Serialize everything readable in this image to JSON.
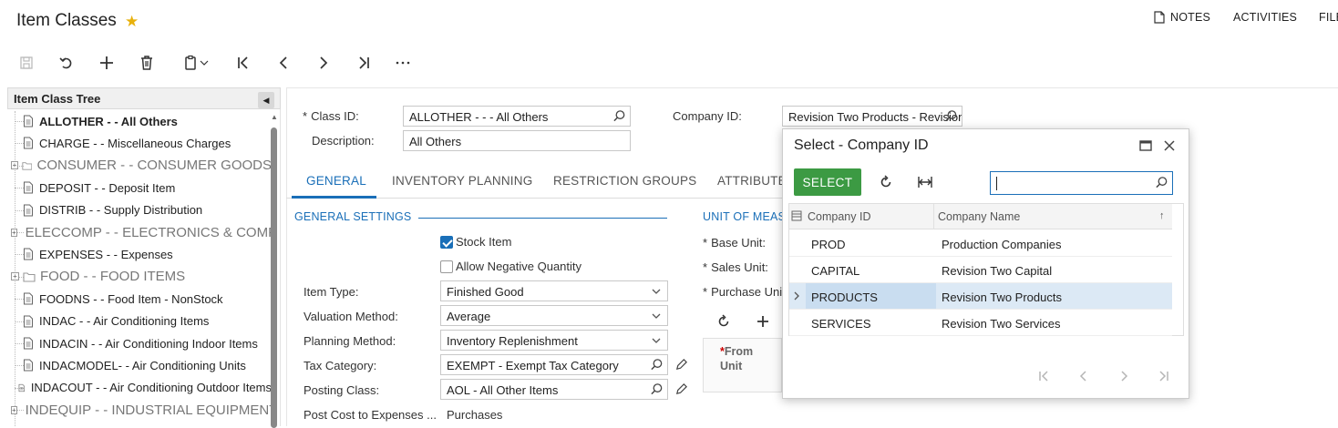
{
  "header": {
    "title": "Item Classes",
    "links": [
      "NOTES",
      "ACTIVITIES",
      "FILE"
    ]
  },
  "tree": {
    "title": "Item Class Tree",
    "items": [
      {
        "label": "ALLOTHER - - All Others",
        "type": "doc",
        "selected": true
      },
      {
        "label": "CHARGE - - Miscellaneous Charges",
        "type": "doc"
      },
      {
        "label": "CONSUMER - - CONSUMER GOODS",
        "type": "folder"
      },
      {
        "label": "DEPOSIT - - Deposit Item",
        "type": "doc"
      },
      {
        "label": "DISTRIB - - Supply Distribution",
        "type": "doc"
      },
      {
        "label": "ELECCOMP - - ELECTRONICS & COMPONENTS",
        "type": "folder"
      },
      {
        "label": "EXPENSES - - Expenses",
        "type": "doc"
      },
      {
        "label": "FOOD - - FOOD ITEMS",
        "type": "folder"
      },
      {
        "label": "FOODNS - - Food Item - NonStock",
        "type": "doc"
      },
      {
        "label": "INDAC - - Air Conditioning Items",
        "type": "doc"
      },
      {
        "label": "INDACIN - - Air Conditioning Indoor Items",
        "type": "doc"
      },
      {
        "label": "INDACMODEL- - Air Conditioning Units",
        "type": "doc"
      },
      {
        "label": "INDACOUT - - Air Conditioning Outdoor Items",
        "type": "doc"
      },
      {
        "label": "INDEQUIP - - INDUSTRIAL EQUIPMENT",
        "type": "folder"
      }
    ]
  },
  "form": {
    "class_id_label": "Class ID:",
    "class_id_value": "ALLOTHER  -   - - All Others",
    "description_label": "Description:",
    "description_value": "All Others",
    "company_id_label": "Company ID:",
    "company_id_value": "Revision Two Products - Revision"
  },
  "tabs": [
    "GENERAL",
    "INVENTORY PLANNING",
    "RESTRICTION GROUPS",
    "ATTRIBUTES"
  ],
  "general": {
    "section_title": "GENERAL SETTINGS",
    "stock_item_label": "Stock Item",
    "allow_negative_label": "Allow Negative Quantity",
    "item_type_label": "Item Type:",
    "item_type_value": "Finished Good",
    "valuation_label": "Valuation Method:",
    "valuation_value": "Average",
    "planning_label": "Planning Method:",
    "planning_value": "Inventory Replenishment",
    "tax_label": "Tax Category:",
    "tax_value": "EXEMPT - Exempt Tax Category",
    "posting_label": "Posting Class:",
    "posting_value": "AOL - All Other Items",
    "post_cost_label": "Post Cost to Expenses ...",
    "post_cost_value": "Purchases"
  },
  "uom": {
    "section_title": "UNIT OF MEASURE",
    "base_unit_label": "Base Unit:",
    "sales_unit_label": "Sales Unit:",
    "purchase_unit_label": "Purchase Unit:",
    "from_unit_header": "From Unit"
  },
  "popup": {
    "title": "Select - Company ID",
    "select_label": "SELECT",
    "columns": [
      "Company ID",
      "Company Name"
    ],
    "rows": [
      {
        "id": "PROD",
        "name": "Production Companies"
      },
      {
        "id": "CAPITAL",
        "name": "Revision Two Capital"
      },
      {
        "id": "PRODUCTS",
        "name": "Revision Two Products",
        "selected": true
      },
      {
        "id": "SERVICES",
        "name": "Revision Two Services"
      }
    ]
  },
  "colors": {
    "accent": "#1a6fb8",
    "select_button": "#3c9a43",
    "star": "#e8b10c"
  }
}
